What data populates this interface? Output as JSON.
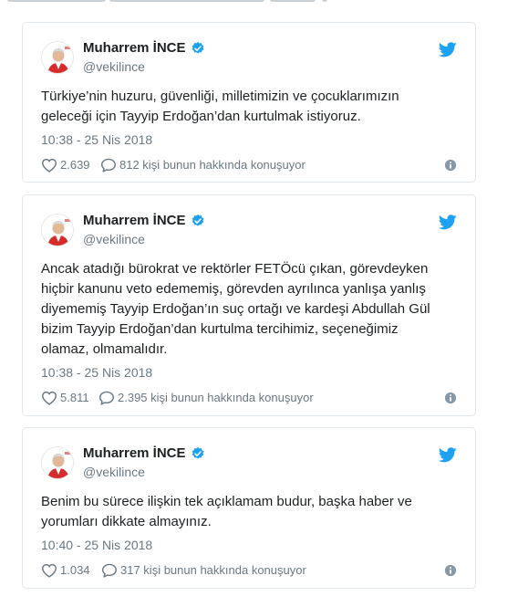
{
  "colors": {
    "twitter_blue": "#1da1f2",
    "verified_blue": "#1da1f2",
    "text_dark": "#1c2022",
    "text_muted": "#697882",
    "border": "#e1e8ed",
    "avatar_red": "#d42c2c"
  },
  "icons": {
    "header": "twitter-bird-icon",
    "verified": "verified-badge-icon",
    "like": "heart-icon",
    "reply": "speech-bubble-icon",
    "info": "info-icon"
  },
  "tweets": [
    {
      "author_name": "Muharrem İNCE",
      "handle": "@vekilince",
      "text_lines": [
        "Türkiye’nin huzuru, güvenliği, milletimizin ve çocuklarımızın",
        "geleceği için Tayyip Erdoğan’dan kurtulmak istiyoruz."
      ],
      "timestamp": "10:38 - 25 Nis 2018",
      "likes": "2.639",
      "conversation": "812 kişi bunun hakkında konuşuyor"
    },
    {
      "author_name": "Muharrem İNCE",
      "handle": "@vekilince",
      "text_lines": [
        "Ancak atadığı bürokrat ve rektörler FETÖcü çıkan, görevdeyken",
        "hiçbir kanunu veto edememiş, görevden ayrılınca yanlışa yanlış",
        "diyememiş Tayyip Erdoğan’ın suç ortağı ve kardeşi Abdullah Gül",
        "bizim Tayyip Erdoğan’dan kurtulma tercihimiz, seçeneğimiz",
        "olamaz, olmamalıdır."
      ],
      "timestamp": "10:38 - 25 Nis 2018",
      "likes": "5.811",
      "conversation": "2.395 kişi bunun hakkında konuşuyor"
    },
    {
      "author_name": "Muharrem İNCE",
      "handle": "@vekilince",
      "text_lines": [
        "Benim bu sürece ilişkin tek açıklamam budur, başka haber ve",
        "yorumları dikkate almayınız."
      ],
      "timestamp": "10:40 - 25 Nis 2018",
      "likes": "1.034",
      "conversation": "317 kişi bunun hakkında konuşuyor"
    }
  ]
}
